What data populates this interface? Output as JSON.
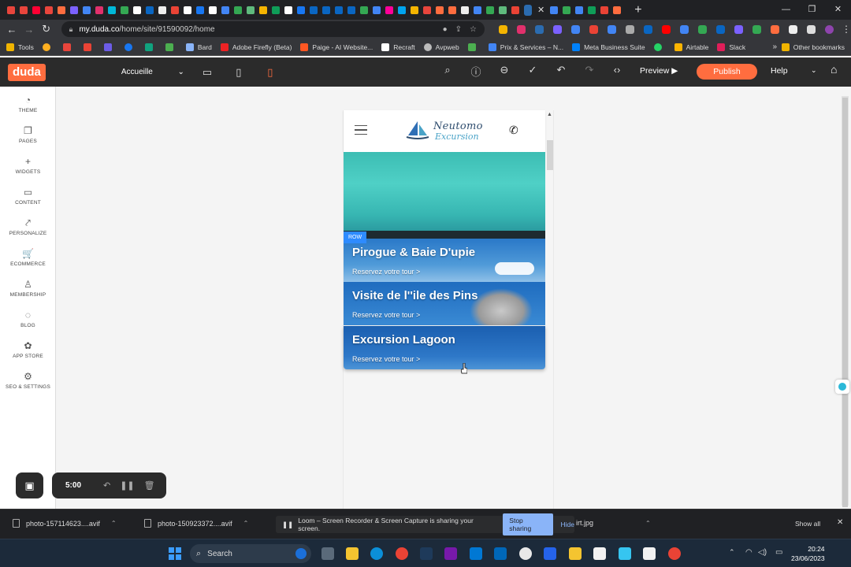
{
  "browser": {
    "url_host": "my.duda.co",
    "url_path": "/home/site/91590092/home",
    "tab_close": "✕",
    "new_tab": "+",
    "win_min": "—",
    "win_max": "❐",
    "win_close": "✕",
    "bookmarks": [
      {
        "label": "Tools",
        "color": "#f0b400"
      },
      {
        "label": "",
        "color": "#ffb020"
      },
      {
        "label": "",
        "color": "#e8453c"
      },
      {
        "label": "",
        "color": "#ea4335"
      },
      {
        "label": "",
        "color": "#6c5ce7"
      },
      {
        "label": "",
        "color": "#1877f2"
      },
      {
        "label": "",
        "color": "#10a37f"
      },
      {
        "label": "",
        "color": "#4caf50"
      },
      {
        "label": "Bard",
        "color": "#8ab4f8"
      },
      {
        "label": "Adobe Firefly (Beta)",
        "color": "#ed2224"
      },
      {
        "label": "Paige - AI Website...",
        "color": "#ff5722"
      },
      {
        "label": "Recraft",
        "color": "#ffffff"
      },
      {
        "label": "Avpweb",
        "color": "#bbbbbb"
      },
      {
        "label": "",
        "color": "#4caf50"
      },
      {
        "label": "Prix & Services – N...",
        "color": "#4285f4"
      },
      {
        "label": "Meta Business Suite",
        "color": "#0081fb"
      },
      {
        "label": "",
        "color": "#25d366"
      },
      {
        "label": "Airtable",
        "color": "#fcb400"
      },
      {
        "label": "Slack",
        "color": "#e01e5a"
      }
    ],
    "bookmarks_more": "»",
    "other_bookmarks": "Other bookmarks"
  },
  "duda": {
    "logo": "duda",
    "page_select": "Accueille",
    "preview": "Preview",
    "publish": "Publish",
    "help": "Help"
  },
  "sidebar": {
    "items": [
      {
        "label": "THEME",
        "icon": "◔"
      },
      {
        "label": "PAGES",
        "icon": "❐"
      },
      {
        "label": "WIDGETS",
        "icon": "+"
      },
      {
        "label": "CONTENT",
        "icon": "▭"
      },
      {
        "label": "PERSONALIZE",
        "icon": "⤤"
      },
      {
        "label": "ECOMMERCE",
        "icon": "🛒"
      },
      {
        "label": "MEMBERSHIP",
        "icon": "♙"
      },
      {
        "label": "BLOG",
        "icon": "◌"
      },
      {
        "label": "APP STORE",
        "icon": "✿"
      },
      {
        "label": "SEO & SETTINGS",
        "icon": "⚙"
      }
    ]
  },
  "site": {
    "logo_name": "Neutomo",
    "logo_sub": "Excursion",
    "row_badge": "ROW",
    "cards": [
      {
        "title": "Pirogue & Baie D'upie",
        "link": "Reservez votre tour >"
      },
      {
        "title": "Visite de l''ile des Pins",
        "link": "Reservez votre tour >"
      },
      {
        "title": "Excursion Lagoon",
        "link": "Reservez votre tour >"
      }
    ]
  },
  "loom": {
    "time": "5:00",
    "share_text": "Loom – Screen Recorder & Screen Capture is sharing your screen.",
    "stop_sharing": "Stop sharing",
    "hide": "Hide"
  },
  "downloads": {
    "items": [
      {
        "name": "photo-157114623....avif"
      },
      {
        "name": "photo-150923372....avif"
      },
      {
        "name": "irt.jpg"
      }
    ],
    "show_all": "Show all"
  },
  "taskbar": {
    "search": "Search",
    "time": "20:24",
    "date": "23/06/2023"
  }
}
